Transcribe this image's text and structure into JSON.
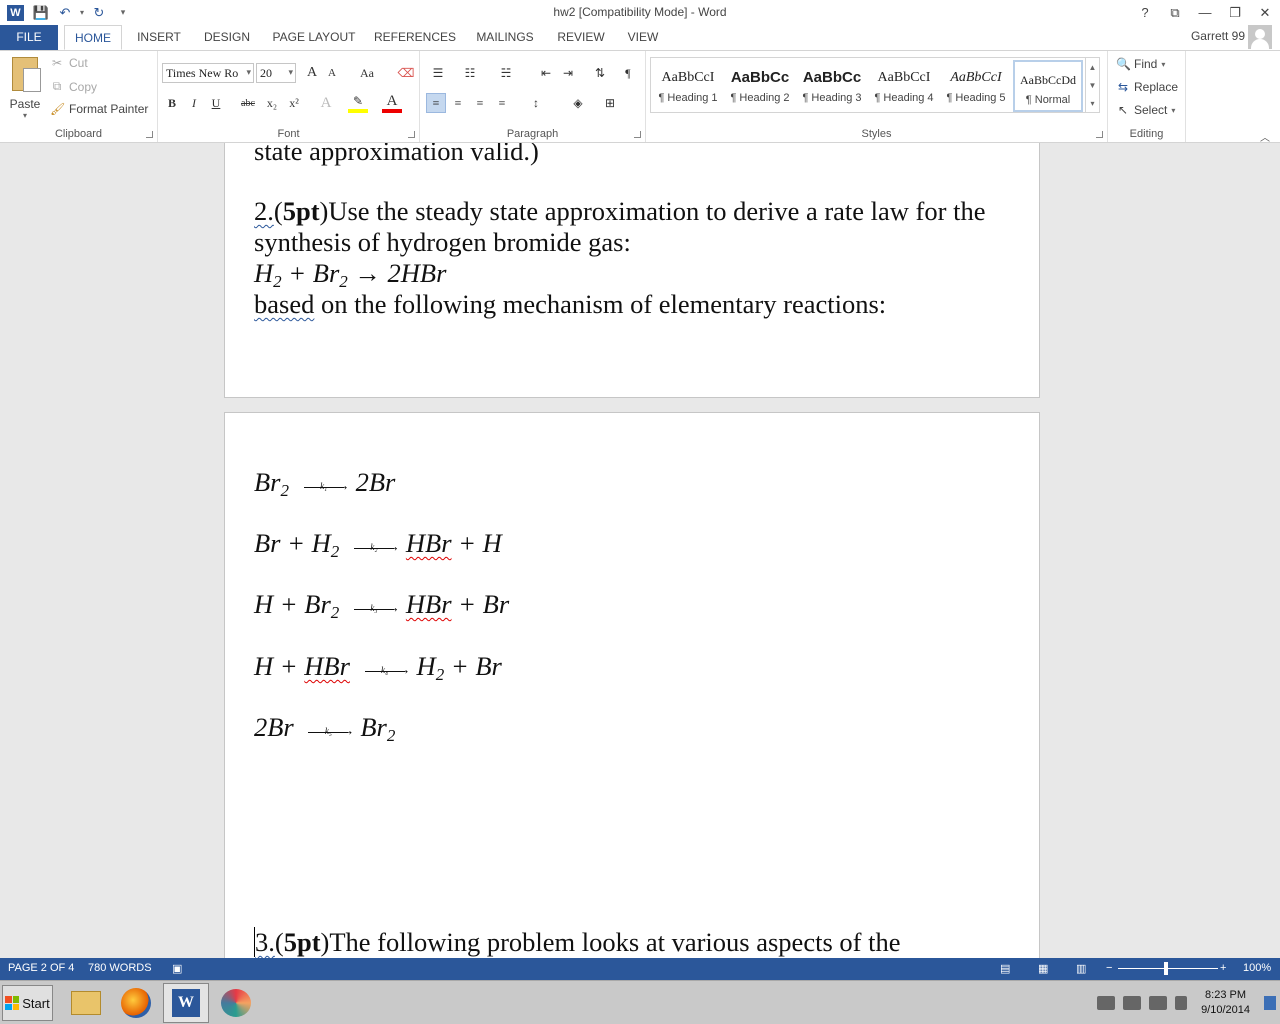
{
  "window": {
    "title": "hw2 [Compatibility Mode] - Word",
    "controls": [
      "?",
      "⧉",
      "—",
      "❐",
      "✕"
    ]
  },
  "tabs": [
    "FILE",
    "HOME",
    "INSERT",
    "DESIGN",
    "PAGE LAYOUT",
    "REFERENCES",
    "MAILINGS",
    "REVIEW",
    "VIEW"
  ],
  "active_tab": "HOME",
  "account": {
    "name": "Garrett 99"
  },
  "clipboard": {
    "paste": "Paste",
    "cut": "Cut",
    "copy": "Copy",
    "format_painter": "Format Painter",
    "label": "Clipboard"
  },
  "font": {
    "name": "Times New Ro",
    "size": "20",
    "label": "Font",
    "buttons": {
      "bold": "B",
      "italic": "I",
      "underline": "U",
      "strike": "abc",
      "sub": "x₂",
      "sup": "x²",
      "grow": "A",
      "shrink": "A",
      "case": "Aa"
    }
  },
  "paragraph": {
    "label": "Paragraph"
  },
  "styles": {
    "label": "Styles",
    "items": [
      {
        "preview": "AaBbCcI",
        "name": "¶ Heading 1"
      },
      {
        "preview": "AaBbCc",
        "name": "¶ Heading 2"
      },
      {
        "preview": "AaBbCc",
        "name": "¶ Heading 3"
      },
      {
        "preview": "AaBbCcI",
        "name": "¶ Heading 4"
      },
      {
        "preview": "AaBbCcI",
        "name": "¶ Heading 5"
      },
      {
        "preview": "AaBbCcDd",
        "name": "¶ Normal"
      }
    ]
  },
  "editing": {
    "label": "Editing",
    "find": "Find",
    "replace": "Replace",
    "select": "Select"
  },
  "document": {
    "line_prev": "state approximation valid.)",
    "q2_num": "2.",
    "q2_open": "(",
    "q2_pts": "5pt",
    "q2_text": ")Use the steady state approximation to derive a rate law for the",
    "q2_line2": "synthesis of hydrogen bromide gas:",
    "reaction": {
      "r1": "H",
      "r1s": "2",
      "plus": " + Br",
      "r2s": "2",
      "arrow": " → ",
      "prod": "2HBr"
    },
    "based_word": "based",
    "based_rest": " on the following mechanism of elementary reactions:",
    "mechanism": [
      {
        "lhs": "Br",
        "lhs_sub": "2",
        "lhs2": "",
        "lhs2_sub": "",
        "k": "k₁",
        "rhs": "2Br",
        "rhs_sub": "",
        "rhs2": ""
      },
      {
        "lhs": "Br + H",
        "lhs_sub": "2",
        "lhs2": "",
        "lhs2_sub": "",
        "k": "k₂",
        "rhs": "HBr",
        "rhs_sub": "",
        "rhs2": " + H"
      },
      {
        "lhs": "H + Br",
        "lhs_sub": "2",
        "lhs2": "",
        "lhs2_sub": "",
        "k": "k₃",
        "rhs": "HBr",
        "rhs_sub": "",
        "rhs2": " + Br"
      },
      {
        "lhs": "H + ",
        "lhs_sub": "",
        "lhs2": "HBr",
        "lhs2_sub": "",
        "k": "k₄",
        "rhs": "H",
        "rhs_sub": "2",
        "rhs2": " + Br"
      },
      {
        "lhs": "2Br",
        "lhs_sub": "",
        "lhs2": "",
        "lhs2_sub": "",
        "k": "k₅",
        "rhs": "Br",
        "rhs_sub": "2",
        "rhs2": ""
      }
    ],
    "q3_num": "3.",
    "q3_open": "(",
    "q3_pts": "5pt",
    "q3_text": ")The following problem looks at various aspects of the"
  },
  "status": {
    "page": "PAGE 2 OF 4",
    "words": "780 WORDS",
    "zoom": "100%"
  },
  "taskbar": {
    "start": "Start",
    "time": "8:23 PM",
    "date": "9/10/2014"
  },
  "colors": {
    "accent": "#2b579a"
  }
}
